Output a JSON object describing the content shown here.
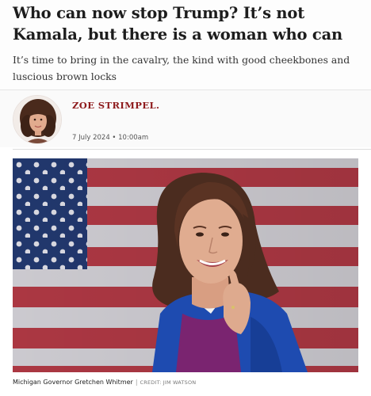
{
  "article": {
    "headline": "Who can now stop Trump? It’s not Kamala, but there is a woman who can",
    "standfirst": "It’s time to bring in the cavalry, the kind with good cheekbones and luscious brown locks"
  },
  "byline": {
    "author": "ZOE STRIMPEL",
    "author_suffix": ".",
    "date": "7 July 2024 • 10:00am"
  },
  "image": {
    "caption": "Michigan Governor Gretchen Whitmer",
    "separator": "|",
    "credit": "CREDIT: JIM WATSON"
  },
  "colors": {
    "author": "#8e1a1c",
    "flag_red": "#b43a46",
    "flag_blue": "#233a72",
    "jacket": "#1e4bb0",
    "sweater": "#7a2470"
  }
}
